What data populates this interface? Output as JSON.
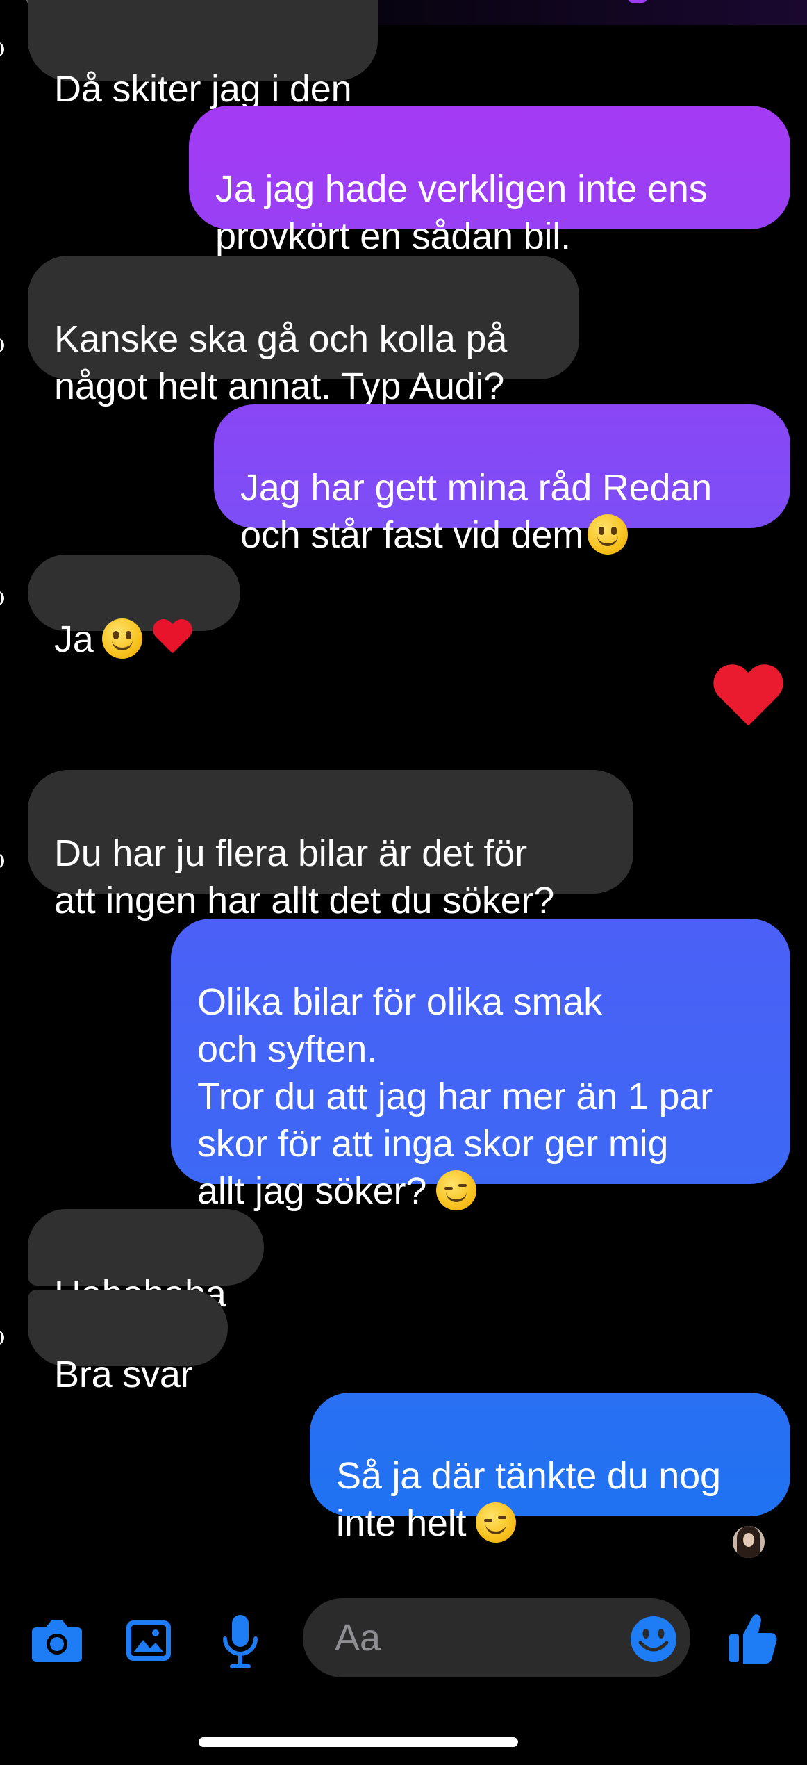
{
  "conversation": {
    "messages": [
      {
        "id": "m1",
        "side": "incoming",
        "text": "Då skiter jag i den"
      },
      {
        "id": "m2",
        "side": "outgoing",
        "text": "Ja jag hade verkligen inte ens\nprovkört en sådan bil."
      },
      {
        "id": "m3",
        "side": "incoming",
        "text": "Kanske ska gå och kolla på\nnågot helt annat. Typ Audi?"
      },
      {
        "id": "m4",
        "side": "outgoing",
        "text": "Jag har gett mina råd Redan\noch står fast vid dem",
        "emoji": "slightly-smiling-face"
      },
      {
        "id": "m5",
        "side": "incoming",
        "text": "Ja",
        "emoji": "slightly-smiling-face",
        "emoji2": "red-heart"
      },
      {
        "id": "m6",
        "side": "outgoing",
        "text": "",
        "emoji": "red-heart-large"
      },
      {
        "id": "m7",
        "side": "incoming",
        "text": "Du har ju flera bilar är det för\natt ingen har allt det du söker?"
      },
      {
        "id": "m8",
        "side": "outgoing",
        "text": "Olika bilar för olika smak\noch syften.\nTror du att jag har mer än 1 par\nskor för att inga skor ger mig\nallt jag söker?",
        "emoji": "winking-face"
      },
      {
        "id": "m9",
        "side": "incoming",
        "text": "Hahahaha"
      },
      {
        "id": "m10",
        "side": "incoming",
        "text": "Bra svar"
      },
      {
        "id": "m11",
        "side": "outgoing",
        "text": "Så ja där tänkte du nog\ninte helt",
        "emoji": "winking-face"
      }
    ]
  },
  "composer": {
    "placeholder": "Aa",
    "icons": [
      "camera-icon",
      "photo-icon",
      "microphone-icon",
      "emoji-icon",
      "thumbs-up-icon"
    ]
  },
  "colors": {
    "incoming_bubble": "#303030",
    "outgoing_gradient_top": "#a23cf5",
    "outgoing_gradient_bottom": "#1e6ff2",
    "accent": "#1e7cf5"
  }
}
